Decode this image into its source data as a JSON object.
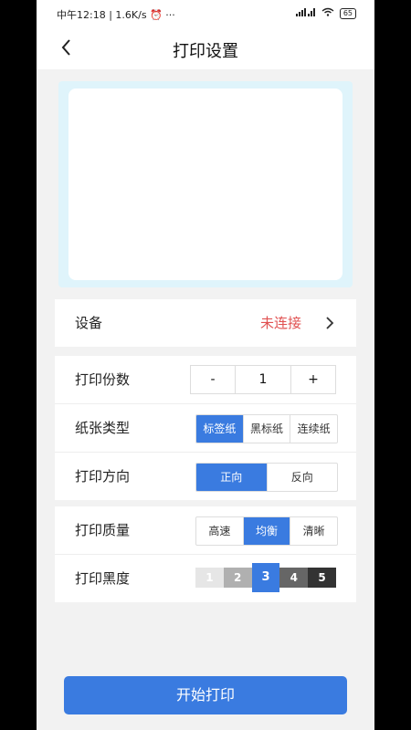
{
  "status_bar": {
    "time": "中午12:18",
    "speed": "1.6K/s",
    "dots": "···",
    "battery": "65"
  },
  "header": {
    "title": "打印设置"
  },
  "device": {
    "label": "设备",
    "status": "未连接"
  },
  "copies": {
    "label": "打印份数",
    "minus": "-",
    "value": "1",
    "plus": "+"
  },
  "paper": {
    "label": "纸张类型",
    "options": [
      "标签纸",
      "黑标纸",
      "连续纸"
    ],
    "selected": "标签纸"
  },
  "direction": {
    "label": "打印方向",
    "options": [
      "正向",
      "反向"
    ],
    "selected": "正向"
  },
  "quality": {
    "label": "打印质量",
    "options": [
      "高速",
      "均衡",
      "清晰"
    ],
    "selected": "均衡"
  },
  "density": {
    "label": "打印黑度",
    "levels": [
      "1",
      "2",
      "3",
      "4",
      "5"
    ],
    "selected": "3"
  },
  "start_button": {
    "label": "开始打印"
  },
  "colors": {
    "accent": "#3a7be0",
    "warning": "#e05050",
    "preview_bg": "#dff4fb"
  }
}
